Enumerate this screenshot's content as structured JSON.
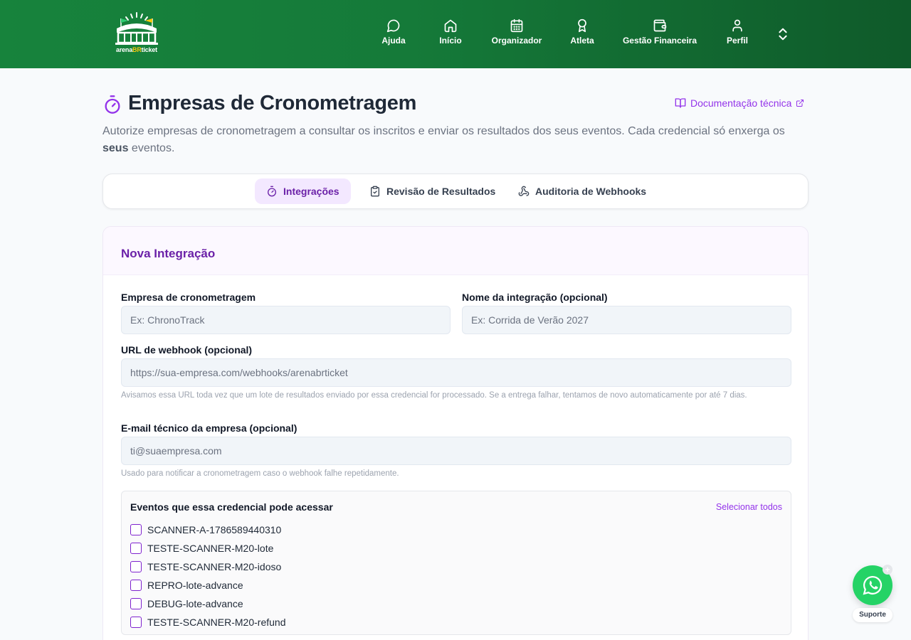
{
  "brand": {
    "logo_text_left": "arena",
    "logo_text_mid": "BR",
    "logo_text_right": "ticket"
  },
  "nav": {
    "items": [
      {
        "label": "Ajuda",
        "icon": "chat-bubble-icon"
      },
      {
        "label": "Início",
        "icon": "home-icon"
      },
      {
        "label": "Organizador",
        "icon": "calendar-icon"
      },
      {
        "label": "Atleta",
        "icon": "medal-icon"
      },
      {
        "label": "Gestão Financeira",
        "icon": "wallet-icon"
      },
      {
        "label": "Perfil",
        "icon": "user-icon"
      }
    ],
    "toggle_icon": "chevron-up-down-icon"
  },
  "page": {
    "title": "Empresas de Cronometragem",
    "doc_link": "Documentação técnica",
    "subtitle_pre": "Autorize empresas de cronometragem a consultar os inscritos e enviar os resultados dos seus eventos. Cada credencial só enxerga os ",
    "subtitle_bold": "seus",
    "subtitle_post": " eventos."
  },
  "tabs": [
    {
      "label": "Integrações",
      "active": true
    },
    {
      "label": "Revisão de Resultados",
      "active": false
    },
    {
      "label": "Auditoria de Webhooks",
      "active": false
    }
  ],
  "form": {
    "title": "Nova Integração",
    "company_label": "Empresa de cronometragem",
    "company_placeholder": "Ex: ChronoTrack",
    "name_label": "Nome da integração (opcional)",
    "name_placeholder": "Ex: Corrida de Verão 2027",
    "webhook_label": "URL de webhook (opcional)",
    "webhook_placeholder": "https://sua-empresa.com/webhooks/arenabrticket",
    "webhook_help": "Avisamos essa URL toda vez que um lote de resultados enviado por essa credencial for processado. Se a entrega falhar, tentamos de novo automaticamente por até 7 dias.",
    "email_label": "E-mail técnico da empresa (opcional)",
    "email_placeholder": "ti@suaempresa.com",
    "email_help": "Usado para notificar a cronometragem caso o webhook falhe repetidamente.",
    "events_title": "Eventos que essa credencial pode acessar",
    "select_all": "Selecionar todos",
    "events": [
      "SCANNER-A-1786589440310",
      "TESTE-SCANNER-M20-lote",
      "TESTE-SCANNER-M20-idoso",
      "REPRO-lote-advance",
      "DEBUG-lote-advance",
      "TESTE-SCANNER-M20-refund"
    ]
  },
  "support": {
    "label": "Suporte",
    "icon": "whatsapp-icon"
  },
  "colors": {
    "header_green": "#17833c",
    "accent_purple": "#9333ea",
    "tab_active_bg": "#f3e8ff",
    "whatsapp": "#25d366"
  }
}
